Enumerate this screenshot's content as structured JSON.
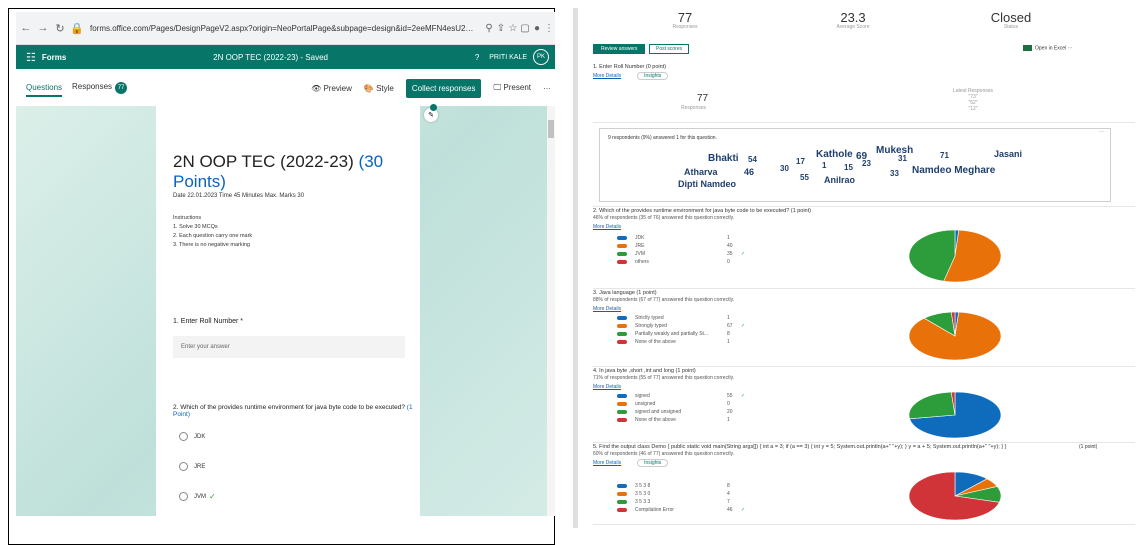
{
  "browser": {
    "url": "forms.office.com/Pages/DesignPageV2.aspx?origin=NeoPortalPage&subpage=design&id=2eeMFN4esU2uh_fUGVAS6CmMKAdY2pNqPl0Ur0nr9URUpGR0pFVkb..."
  },
  "header": {
    "app_name": "Forms",
    "form_title_saved": "2N OOP TEC (2022-23) - Saved",
    "help": "?",
    "user_name": "PRITI KALE",
    "user_initials": "PK"
  },
  "toolbar": {
    "questions_tab": "Questions",
    "responses_tab": "Responses",
    "responses_badge": "77",
    "preview": "Preview",
    "style": "Style",
    "collect": "Collect responses",
    "present": "Present"
  },
  "form": {
    "title": "2N OOP TEC (2022-23)",
    "points": "(30 Points)",
    "meta": "Date 22.01.2023 Time 45 Minutes Max. Marks 30",
    "instructions_head": "Instructions",
    "instructions": [
      "1. Solve 30 MCQs",
      "2. Each question carry one mark",
      "3. There is no negative marking"
    ],
    "q1": "1. Enter Roll Number *",
    "q1_placeholder": "Enter your answer",
    "q2": "2. Which of the  provides runtime environment for java byte code to be executed?",
    "q2_points": "(1 Point)",
    "q2_options": [
      "JDK",
      "JRE",
      "JVM"
    ]
  },
  "summary": {
    "responses": "77",
    "responses_label": "Responses",
    "avg": "23.3",
    "avg_label": "Average Score",
    "status": "Closed",
    "status_label": "Status",
    "review": "Review answers",
    "post": "Post scores",
    "excel": "Open in Excel",
    "q1_title": "1. Enter Roll Number (0 point)",
    "more_details": "More Details",
    "insights": "Insights",
    "q1_count": "77",
    "q1_count_label": "Responses",
    "latest_label": "Latest Responses",
    "latest": [
      "\"73\"",
      "\"52\"",
      "\"12\""
    ],
    "wc_head": "9 respondents (9%) answered 1 for this question.",
    "wc_words": [
      "Bhakti",
      "54",
      "Kathole",
      "69",
      "Mukesh",
      "Jasani",
      "Atharva",
      "46",
      "30",
      "17",
      "1",
      "15",
      "23",
      "31",
      "71",
      "33",
      "Namdeo Meghare",
      "Dipti Namdeo",
      "55",
      "Anilrao"
    ],
    "q2_title": "2. Which of the  provides runtime environment for java byte code to be executed? (1 point)",
    "q2_sub": "46% of respondents (35 of 76) answered this question correctly.",
    "q2_opts": [
      "JDK",
      "JRE",
      "JVM",
      "others"
    ],
    "q2_counts": [
      "1",
      "40",
      "35",
      "0"
    ],
    "q3_title": "3. Java language (1 point)",
    "q3_sub": "88% of respondents (67 of 77) answered this question correctly.",
    "q3_opts": [
      "Strictly typed",
      "Strongly typed",
      "Partially weakly and partially St...",
      "None of the above"
    ],
    "q3_counts": [
      "1",
      "67",
      "8",
      "1"
    ],
    "q4_title": "4. In java byte ,short ,int and long (1 point)",
    "q4_sub": "71% of respondents (55 of 77) answered this question correctly.",
    "q4_opts": [
      "signed",
      "unsigned",
      "signed and unsigned",
      "None of the above"
    ],
    "q4_counts": [
      "55",
      "0",
      "20",
      "1"
    ],
    "q5_title": "5. Find the output class Demo { public static void main(String args[]) { int a = 3; if (a == 3) { int y = 5; System.out.println(a+\" \"+y); } y = a + 5; System.out.println(a+\" \"+y); } }",
    "q5_pts": "(1 point)",
    "q5_sub": "60% of respondents (46 of 77) answered this question correctly.",
    "q5_opts": [
      "3 5 3 8",
      "3 5 3 0",
      "3 5 3 3",
      "Compilation Error"
    ],
    "q5_counts": [
      "8",
      "4",
      "7",
      "46"
    ]
  },
  "pies": {
    "q2": [
      {
        "v": 1,
        "c": "#0f6cbd"
      },
      {
        "v": 40,
        "c": "#e8710a"
      },
      {
        "v": 35,
        "c": "#2d9c3b"
      },
      {
        "v": 0,
        "c": "#d13438"
      }
    ],
    "q3": [
      {
        "v": 1,
        "c": "#0f6cbd"
      },
      {
        "v": 67,
        "c": "#e8710a"
      },
      {
        "v": 8,
        "c": "#2d9c3b"
      },
      {
        "v": 1,
        "c": "#d13438"
      }
    ],
    "q4": [
      {
        "v": 55,
        "c": "#0f6cbd"
      },
      {
        "v": 0,
        "c": "#e8710a"
      },
      {
        "v": 20,
        "c": "#2d9c3b"
      },
      {
        "v": 1,
        "c": "#d13438"
      }
    ],
    "q5": [
      {
        "v": 8,
        "c": "#0f6cbd"
      },
      {
        "v": 4,
        "c": "#e8710a"
      },
      {
        "v": 7,
        "c": "#2d9c3b"
      },
      {
        "v": 46,
        "c": "#d13438"
      }
    ]
  },
  "colors": {
    "brand": "#077568",
    "blue": "#0f6cbd",
    "orange": "#e8710a",
    "green": "#2d9c3b",
    "red": "#d13438"
  }
}
